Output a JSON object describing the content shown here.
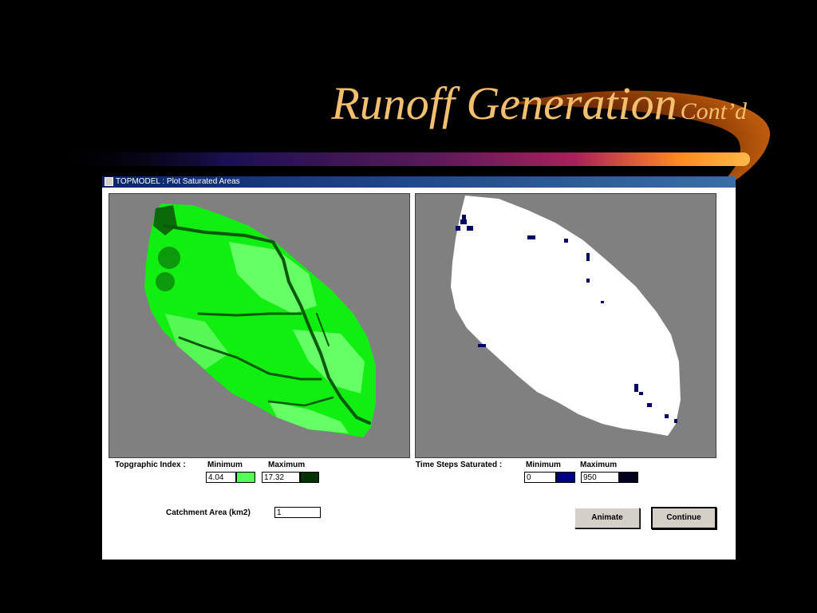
{
  "slide": {
    "title": "Runoff Generation",
    "subtitle": "Cont’d"
  },
  "window": {
    "title": "TOPMODEL : Plot Saturated Areas"
  },
  "topographic_index": {
    "label": "Topgraphic Index :",
    "min_label": "Minimum",
    "max_label": "Maximum",
    "min_value": "4.04",
    "max_value": "17.32",
    "min_color": "#55ff55",
    "max_color": "#003300"
  },
  "time_steps": {
    "label": "Time Steps Saturated :",
    "min_label": "Minimum",
    "max_label": "Maximum",
    "min_value": "0",
    "max_value": "950",
    "min_color": "#000080",
    "max_color": "#000020"
  },
  "catchment": {
    "label": "Catchment Area (km2)",
    "value": "1"
  },
  "buttons": {
    "animate": "Animate",
    "continue": "Continue"
  },
  "colors": {
    "panel_background": "#808080",
    "topo_base": "#11ee11",
    "topo_light": "#66ff66",
    "topo_dark": "#0a6a0a",
    "saturated": "#000066",
    "unsaturated": "#ffffff"
  }
}
